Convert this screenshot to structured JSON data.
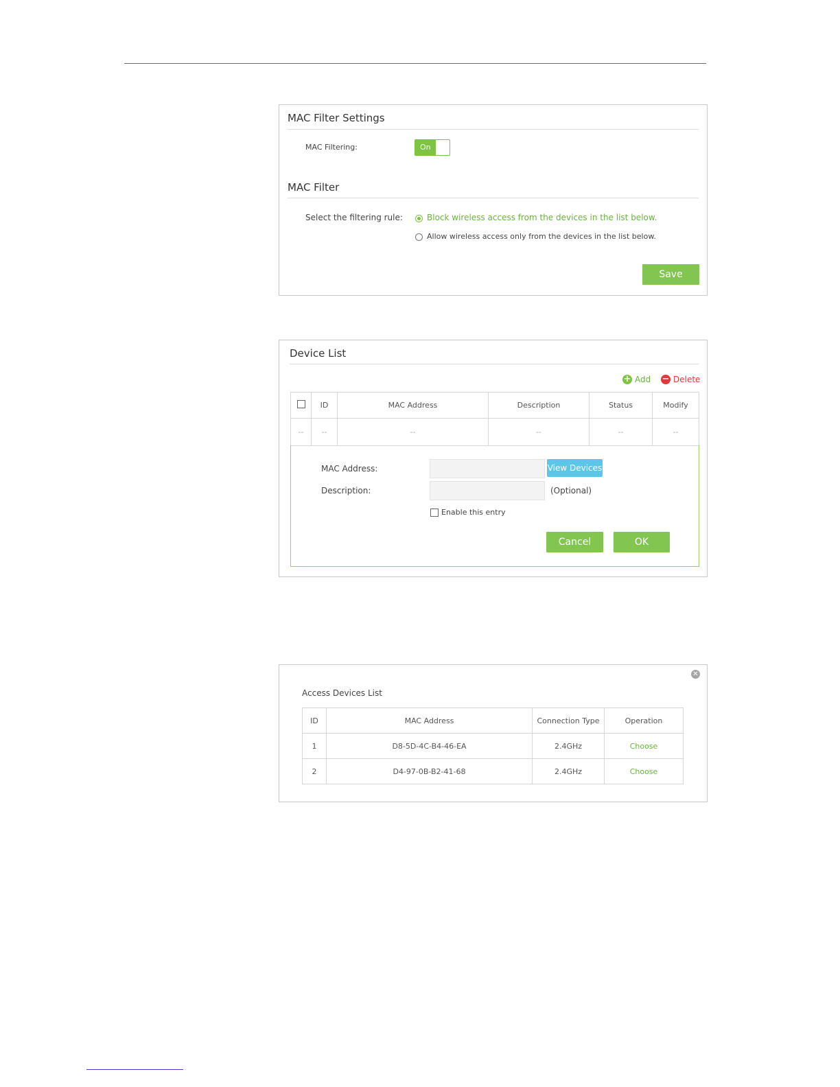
{
  "mac_filter_settings": {
    "title": "MAC Filter Settings",
    "mac_filtering_label": "MAC Filtering:",
    "toggle_state": "On"
  },
  "mac_filter": {
    "title": "MAC Filter",
    "rule_label": "Select the filtering rule:",
    "options": [
      {
        "label": "Block wireless access from the devices in the list below.",
        "selected": true
      },
      {
        "label": "Allow wireless access only from the devices in the list below.",
        "selected": false
      }
    ],
    "save_label": "Save"
  },
  "device_list": {
    "title": "Device List",
    "add_label": "Add",
    "delete_label": "Delete",
    "columns": [
      "ID",
      "MAC Address",
      "Description",
      "Status",
      "Modify"
    ],
    "empty_row": [
      "--",
      "--",
      "--",
      "--",
      "--",
      "--"
    ],
    "form": {
      "mac_label": "MAC Address:",
      "mac_value": "",
      "view_devices_label": "View Devices",
      "description_label": "Description:",
      "description_value": "",
      "optional_label": "(Optional)",
      "enable_label": "Enable this entry",
      "cancel_label": "Cancel",
      "ok_label": "OK"
    }
  },
  "access_devices": {
    "title": "Access Devices List",
    "columns": [
      "ID",
      "MAC Address",
      "Connection Type",
      "Operation"
    ],
    "rows": [
      {
        "id": "1",
        "mac": "D8-5D-4C-B4-46-EA",
        "type": "2.4GHz",
        "op": "Choose"
      },
      {
        "id": "2",
        "mac": "D4-97-0B-B2-41-68",
        "type": "2.4GHz",
        "op": "Choose"
      }
    ]
  },
  "colors": {
    "accent_green": "#7cc441",
    "accent_blue": "#5bc6e8",
    "delete_red": "#e0383b"
  }
}
